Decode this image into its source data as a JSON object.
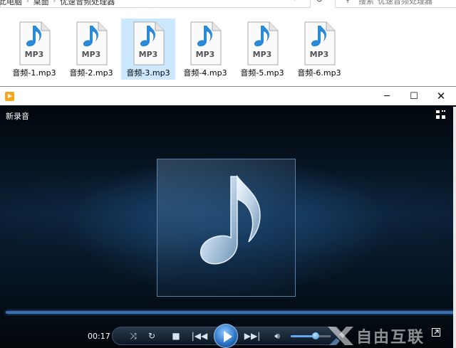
{
  "explorer": {
    "breadcrumb": [
      "此电脑",
      "桌面",
      "优速音频处理器"
    ],
    "search_placeholder": "搜索\"优速音频处理器\"",
    "files": [
      {
        "name": "音频-1.mp3",
        "type": "MP3",
        "selected": false
      },
      {
        "name": "音频-2.mp3",
        "type": "MP3",
        "selected": false
      },
      {
        "name": "音频-3.mp3",
        "type": "MP3",
        "selected": true
      },
      {
        "name": "音频-4.mp3",
        "type": "MP3",
        "selected": false
      },
      {
        "name": "音频-5.mp3",
        "type": "MP3",
        "selected": false
      },
      {
        "name": "音频-6.mp3",
        "type": "MP3",
        "selected": false
      }
    ]
  },
  "player": {
    "window_controls": {
      "minimize": "─",
      "maximize": "☐",
      "close": "✕"
    },
    "track_title": "新录音",
    "time": "00:17",
    "volume_level": 0.62,
    "icons": {
      "shuffle": "shuffle-icon",
      "repeat": "repeat-icon",
      "stop": "stop-icon",
      "previous": "previous-icon",
      "play": "play-icon",
      "next": "next-icon",
      "mute": "speaker-icon",
      "fullscreen": "fullscreen-icon",
      "layout": "switch-layout-icon",
      "album_art": "music-note-icon"
    },
    "colors": {
      "accent": "#3a6fb0",
      "play_button": "#2a6fc0"
    }
  },
  "watermark": {
    "text": "自由互联"
  }
}
